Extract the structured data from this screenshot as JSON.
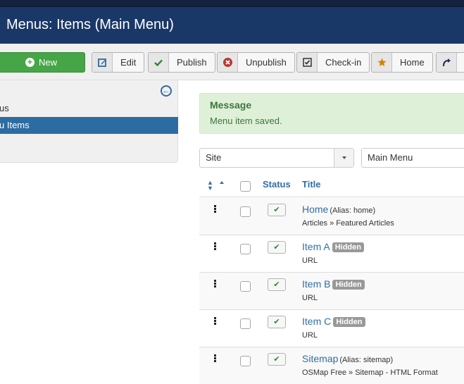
{
  "header": {
    "title": "Menus: Items (Main Menu)"
  },
  "toolbar": {
    "buttons": [
      {
        "label": "New",
        "icon": "plus-circle-icon"
      },
      {
        "label": "Edit",
        "icon": "edit-icon"
      },
      {
        "label": "Publish",
        "icon": "check-icon"
      },
      {
        "label": "Unpublish",
        "icon": "times-circle-icon"
      },
      {
        "label": "Check-in",
        "icon": "checkbox-icon"
      },
      {
        "label": "Home",
        "icon": "star-icon"
      },
      {
        "label": "",
        "icon": "rebuild-icon"
      }
    ]
  },
  "sidebar": {
    "items": [
      {
        "label": "us",
        "active": false
      },
      {
        "label": "u Items",
        "active": true
      }
    ]
  },
  "message": {
    "heading": "Message",
    "body": "Menu item saved."
  },
  "filters": {
    "client": {
      "value": "Site"
    },
    "menu": {
      "value": "Main Menu"
    }
  },
  "table": {
    "headers": {
      "status": "Status",
      "title": "Title"
    },
    "rows": [
      {
        "title": "Home",
        "alias": "(Alias: home)",
        "badge": "",
        "sub": "Articles » Featured Articles",
        "published": true
      },
      {
        "title": "Item A",
        "alias": "",
        "badge": "Hidden",
        "sub": "URL",
        "published": true
      },
      {
        "title": "Item B",
        "alias": "",
        "badge": "Hidden",
        "sub": "URL",
        "published": true
      },
      {
        "title": "Item C",
        "alias": "",
        "badge": "Hidden",
        "sub": "URL",
        "published": true
      },
      {
        "title": "Sitemap",
        "alias": "(Alias: sitemap)",
        "badge": "",
        "sub": "OSMap Free » Sitemap - HTML Format",
        "published": true
      }
    ]
  },
  "colors": {
    "header_bg": "#1a3867",
    "accent": "#2d6ca2",
    "success": "#46a546",
    "danger": "#bd362f",
    "warning": "#d6800b"
  }
}
